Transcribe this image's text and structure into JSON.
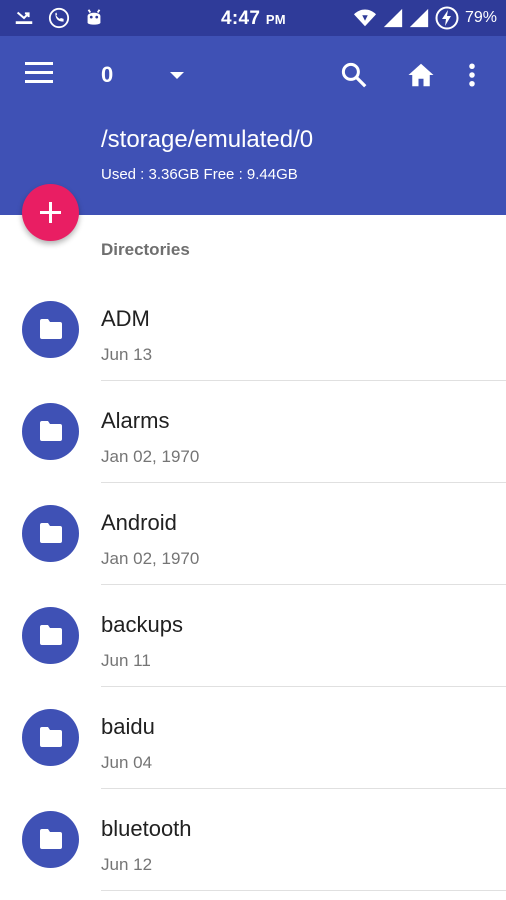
{
  "status_bar": {
    "time": "4:47",
    "ampm": "PM",
    "battery_percent": "79%",
    "icons": [
      "missed-call-icon",
      "call-icon",
      "android-debug-icon",
      "wifi-icon",
      "signal-icon",
      "signal-icon-2",
      "battery-charging-icon"
    ]
  },
  "app_bar": {
    "tab_title": "0",
    "path": "/storage/emulated/0",
    "usage": "Used : 3.36GB Free : 9.44GB",
    "actions": [
      "search-icon",
      "home-icon",
      "more-vert-icon"
    ]
  },
  "section": {
    "header": "Directories"
  },
  "items": [
    {
      "name": "ADM",
      "date": "Jun 13"
    },
    {
      "name": "Alarms",
      "date": "Jan 02, 1970"
    },
    {
      "name": "Android",
      "date": "Jan 02, 1970"
    },
    {
      "name": "backups",
      "date": "Jun 11"
    },
    {
      "name": "baidu",
      "date": "Jun 04"
    },
    {
      "name": "bluetooth",
      "date": "Jun 12"
    }
  ],
  "colors": {
    "status_bar": "#2f3b99",
    "primary": "#3f51b5",
    "accent": "#e91e63"
  }
}
